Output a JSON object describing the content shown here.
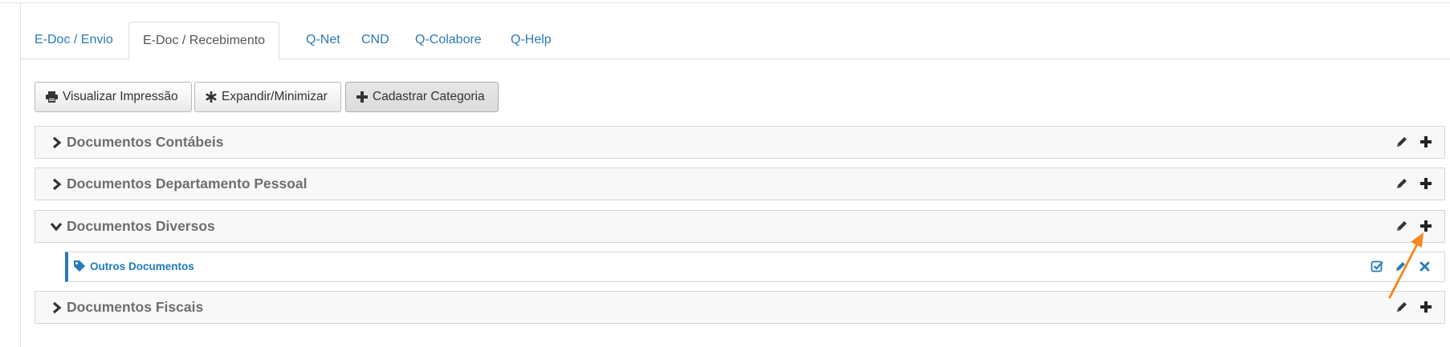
{
  "tabs": [
    {
      "label": "E-Doc / Envio"
    },
    {
      "label": "E-Doc / Recebimento"
    },
    {
      "label": "Q-Net"
    },
    {
      "label": "CND"
    },
    {
      "label": "Q-Colabore"
    },
    {
      "label": "Q-Help"
    }
  ],
  "active_tab": "E-Doc / Recebimento",
  "toolbar": {
    "print_label": "Visualizar Impressão",
    "expand_label": "Expandir/Minimizar",
    "add_category_label": "Cadastrar Categoria"
  },
  "categories": [
    {
      "title": "Documentos Contábeis",
      "expanded": false
    },
    {
      "title": "Documentos Departamento Pessoal",
      "expanded": false
    },
    {
      "title": "Documentos Diversos",
      "expanded": true,
      "children": [
        {
          "title": "Outros Documentos"
        }
      ]
    },
    {
      "title": "Documentos Fiscais",
      "expanded": false
    }
  ],
  "icons": {
    "print": "print-icon",
    "expand": "asterisk-icon",
    "add": "plus-icon",
    "edit": "pencil-icon",
    "collapsed": "chevron-right-icon",
    "expanded": "chevron-down-icon",
    "tag": "tag-icon",
    "check": "checkbox-icon",
    "delete": "close-icon",
    "annotation": "arrow-annotation"
  },
  "colors": {
    "link": "#2a7ab8",
    "panel_title": "#6e6e6e",
    "subcategory_title": "#1e7bbf",
    "annotation_arrow": "#f5891f"
  }
}
